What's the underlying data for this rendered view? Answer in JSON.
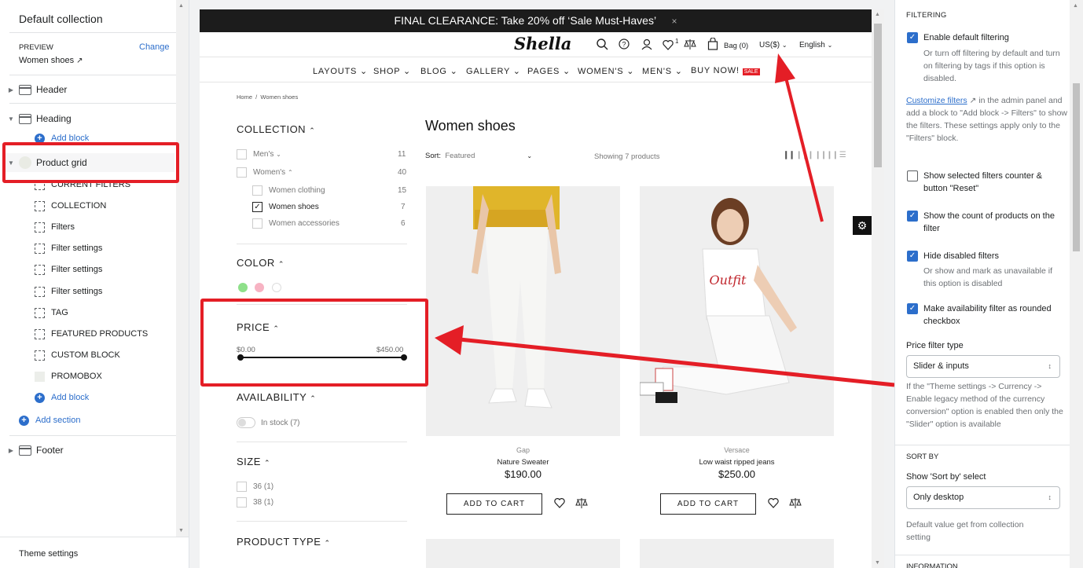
{
  "left": {
    "title": "Default collection",
    "preview_label": "PREVIEW",
    "change": "Change",
    "preview_page": "Women shoes",
    "sections": {
      "header": "Header",
      "heading": "Heading",
      "add_block_heading": "Add block",
      "product_grid": "Product grid",
      "blocks": [
        "CURRENT FILTERS",
        "COLLECTION",
        "Filters",
        "Filter settings",
        "Filter settings",
        "Filter settings",
        "TAG",
        "FEATURED PRODUCTS",
        "CUSTOM BLOCK",
        "PROMOBOX"
      ],
      "add_block": "Add block",
      "add_section": "Add section",
      "footer": "Footer"
    },
    "theme_settings": "Theme settings"
  },
  "preview": {
    "banner": "FINAL CLEARANCE: Take 20% off ‘Sale Must-Haves’",
    "banner_close": "×",
    "logo": "Shella",
    "wish_count": "1",
    "bag": "Bag (0)",
    "currency": "US($)",
    "language": "English",
    "nav": [
      "LAYOUTS",
      "SHOP",
      "BLOG",
      "GALLERY",
      "PAGES",
      "WOMEN'S",
      "MEN'S",
      "BUY NOW!"
    ],
    "sale_badge": "SALE",
    "breadcrumb": "Home  /  Women shoes",
    "filters": {
      "collection": "COLLECTION",
      "mens": "Men's",
      "mens_count": "11",
      "womens": "Women's",
      "womens_count": "40",
      "women_clothing": "Women clothing",
      "women_clothing_count": "15",
      "women_shoes": "Women shoes",
      "women_shoes_count": "7",
      "women_accessories": "Women accessories",
      "women_accessories_count": "6",
      "color": "COLOR",
      "colors": [
        "#8ee08a",
        "#f7b3c3",
        "#ffffff"
      ],
      "price": "PRICE",
      "price_min": "$0.00",
      "price_max": "$450.00",
      "availability": "AVAILABILITY",
      "in_stock": "In stock (7)",
      "size": "SIZE",
      "size_36": "36 (1)",
      "size_38": "38 (1)",
      "product_type": "PRODUCT TYPE"
    },
    "collection_title": "Women shoes",
    "sort_label": "Sort:",
    "sort_value": "Featured",
    "showing": "Showing 7 products",
    "products": [
      {
        "vendor": "Gap",
        "name": "Nature Sweater",
        "price": "$190.00",
        "button": "ADD TO CART"
      },
      {
        "vendor": "Versace",
        "name": "Low waist ripped jeans",
        "price": "$250.00",
        "button": "ADD TO CART",
        "shirt_text": "Outfit"
      }
    ]
  },
  "right": {
    "section_filtering": "FILTERING",
    "enable_default": "Enable default filtering",
    "enable_default_help": "Or turn off filtering by default and turn on filtering by tags if this option is disabled.",
    "customize_link": "Customize filters",
    "customize_help_1": "in the admin panel",
    "customize_help_2": "and add a block to \"Add block -> Filters\" to show the filters. These settings apply only to the \"Filters\" block.",
    "show_counter": "Show selected filters counter & button \"Reset\"",
    "show_count": "Show the count of products on the filter",
    "hide_disabled": "Hide disabled filters",
    "hide_disabled_help": "Or show and mark as unavailable if this option is disabled",
    "rounded_checkbox": "Make availability filter as rounded checkbox",
    "price_filter_label": "Price filter type",
    "price_filter_value": "Slider & inputs",
    "price_filter_help": "If the \"Theme settings -> Currency -> Enable legacy method of the currency conversion\" option is enabled then only the \"Slider\" option is available",
    "section_sortby": "SORT BY",
    "show_sortby_label": "Show 'Sort by' select",
    "show_sortby_value": "Only desktop",
    "sortby_help": "Default value get from collection setting",
    "section_next": "INFORMATION"
  }
}
